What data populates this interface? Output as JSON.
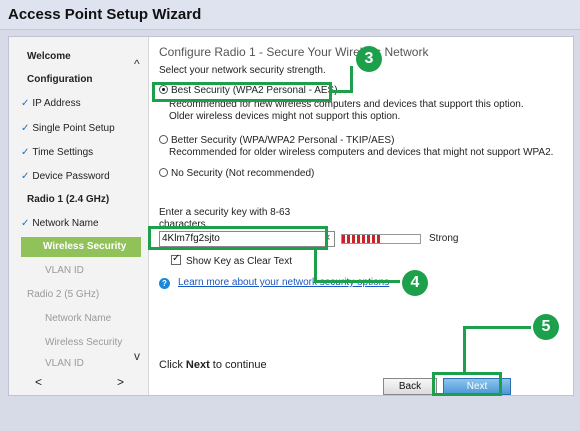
{
  "window": {
    "title": "Access Point Setup Wizard"
  },
  "sidebar": {
    "items": [
      {
        "label": "Welcome",
        "check": "",
        "style": "bold"
      },
      {
        "label": "Configuration",
        "check": "",
        "style": "bold"
      },
      {
        "label": "IP Address",
        "check": "✓",
        "style": "sub"
      },
      {
        "label": "Single Point Setup",
        "check": "✓",
        "style": "sub"
      },
      {
        "label": "Time Settings",
        "check": "✓",
        "style": "sub"
      },
      {
        "label": "Device Password",
        "check": "✓",
        "style": "sub"
      },
      {
        "label": "Radio 1 (2.4 GHz)",
        "check": "",
        "style": "bold"
      },
      {
        "label": "Network Name",
        "check": "✓",
        "style": "sub"
      },
      {
        "label": "Wireless Security",
        "check": "",
        "style": "active"
      },
      {
        "label": "VLAN ID",
        "check": "",
        "style": "disabled indent"
      },
      {
        "label": "Radio 2 (5 GHz)",
        "check": "",
        "style": "disabled"
      },
      {
        "label": "Network Name",
        "check": "",
        "style": "disabled indent"
      },
      {
        "label": "Wireless Security",
        "check": "",
        "style": "disabled indent"
      },
      {
        "label": "VLAN ID",
        "check": "",
        "style": "disabled indent"
      }
    ],
    "scroll_up": "^",
    "scroll_down": "v",
    "scroll_left": "<",
    "scroll_right": ">"
  },
  "main": {
    "heading": "Configure Radio 1 - Secure Your Wireless Network",
    "subhead": "Select your network security strength.",
    "options": [
      {
        "label": "Best Security (WPA2 Personal - AES)",
        "selected": true,
        "desc1": "Recommended for new wireless computers and devices that support this option.",
        "desc2": "Older wireless devices might not support this option."
      },
      {
        "label": "Better Security (WPA/WPA2 Personal - TKIP/AES)",
        "selected": false,
        "desc1": "Recommended for older wireless computers and devices that might not support WPA2.",
        "desc2": ""
      },
      {
        "label": "No Security (Not recommended)",
        "selected": false,
        "desc1": "",
        "desc2": ""
      }
    ],
    "key_prompt": "Enter a security key with 8-63 characters.",
    "key_value": "4Klm7fg2sjto",
    "clear_icon": "×",
    "strength_label": "Strong",
    "strength_fraction": 0.5,
    "strength_color": "#c8242a",
    "show_key_label": "Show Key as Clear Text",
    "show_key_checked": true,
    "help_icon": "?",
    "help_link": "Learn more about your network security options",
    "footer_prefix": "Click ",
    "footer_bold": "Next",
    "footer_suffix": " to continue",
    "back_label": "Back",
    "next_label": "Next"
  },
  "callouts": {
    "step3": "3",
    "step4": "4",
    "step5": "5",
    "color": "#1ca04b"
  }
}
